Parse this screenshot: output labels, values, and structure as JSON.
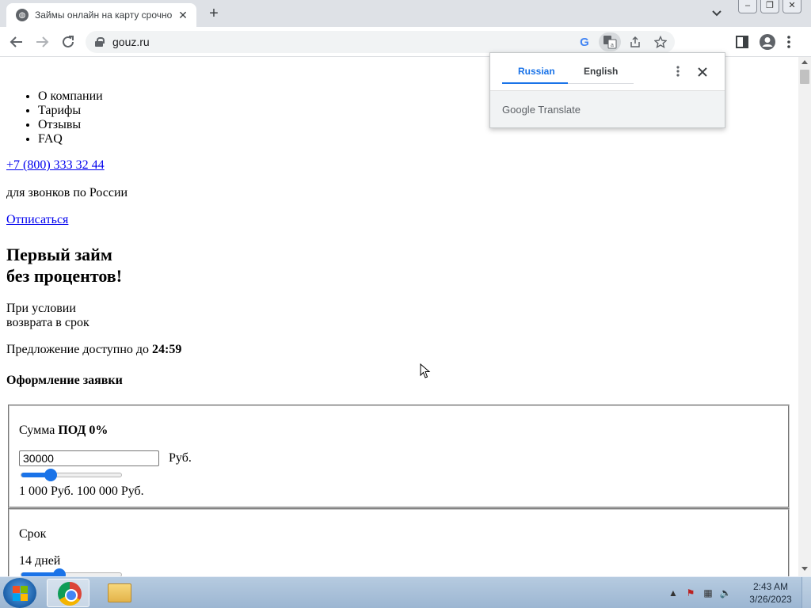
{
  "browser": {
    "tab_title": "Займы онлайн на карту срочно",
    "tab_close_label": "✕",
    "new_tab_label": "+",
    "url": "gouz.ru"
  },
  "translate_popup": {
    "lang_source": "Russian",
    "lang_target": "English",
    "brand": "Google Translate"
  },
  "page": {
    "nav_items": [
      "О компании",
      "Тарифы",
      "Отзывы",
      "FAQ"
    ],
    "phone": "+7 (800) 333 32 44",
    "phone_note": "для звонков по России",
    "unsubscribe": "Отписаться",
    "headline_line1": "Первый займ",
    "headline_line2": "без процентов!",
    "condition_line1": "При условии",
    "condition_line2": "возврата в срок",
    "offer_text": "Предложение доступно до ",
    "offer_time": "24:59",
    "form_title": "Оформление заявки",
    "amount": {
      "label": "Сумма ",
      "label_bold": "ПОД 0%",
      "value": "30000",
      "unit": "Руб.",
      "range_text": "1 000 Руб. 100 000 Руб.",
      "slider_fraction": 0.29
    },
    "term": {
      "label": "Срок",
      "value_text": "14 дней",
      "slider_fraction": 0.38
    }
  },
  "taskbar": {
    "time": "2:43 AM",
    "date": "3/26/2023"
  },
  "colors": {
    "link": "#0000ee",
    "accent": "#1a73e8",
    "taskbar": "#a8c0da"
  }
}
